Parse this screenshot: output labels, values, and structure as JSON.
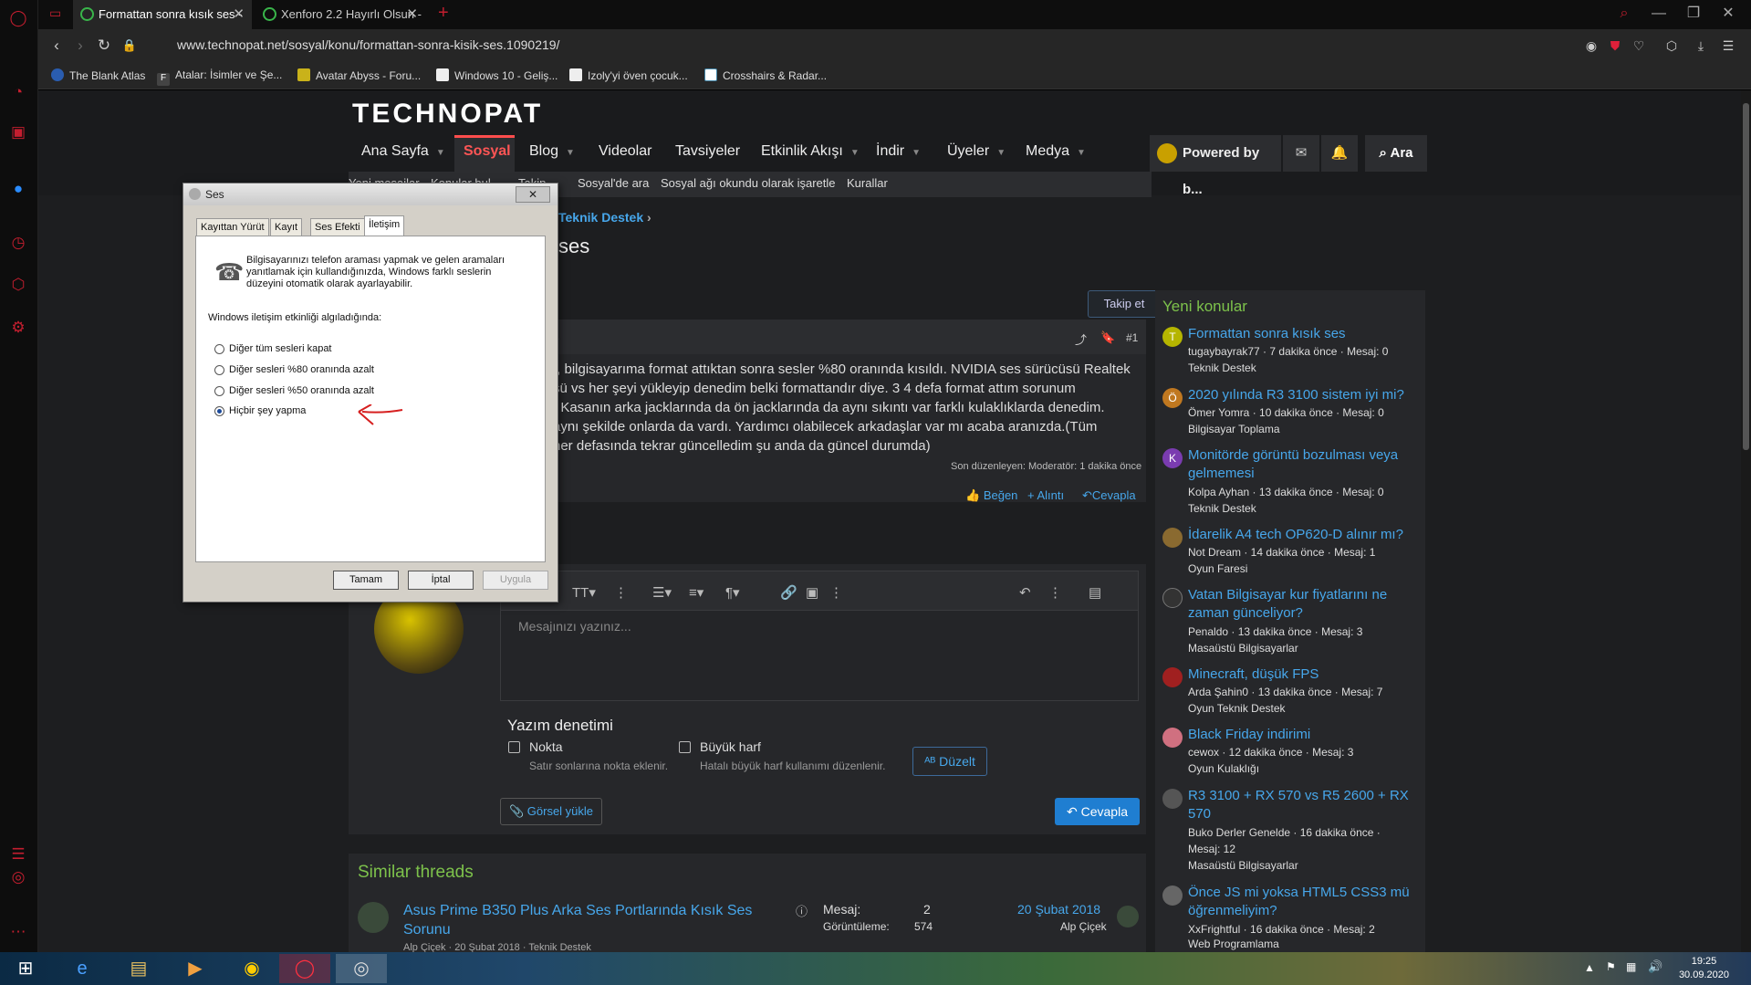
{
  "browser": {
    "tabs": [
      {
        "title": "Formattan sonra kısık ses -",
        "active": true
      },
      {
        "title": "Xenforo 2.2 Hayırlı Olsun -",
        "active": false
      }
    ],
    "url": "www.technopat.net/sosyal/konu/formattan-sonra-kisik-ses.1090219/",
    "bookmarks": [
      "The Blank Atlas",
      "Atalar: İsimler ve Şe...",
      "Avatar Abyss - Foru...",
      "Windows 10 - Geliş...",
      "Izoly'yi öven çocuk...",
      "Crosshairs & Radar..."
    ]
  },
  "site": {
    "logo": "TECHNOPAT",
    "nav": [
      "Ana Sayfa",
      "Sosyal",
      "Blog",
      "Videolar",
      "Tavsiyeler",
      "Etkinlik Akışı",
      "İndir",
      "Üyeler",
      "Medya"
    ],
    "subnav": [
      "Yeni mesajlar",
      "Konular bul",
      "Takip",
      "Sosyal'de ara",
      "Sosyal ağı okundu olarak işaretle",
      "Kurallar"
    ],
    "user": "Powered by b...",
    "search": "Ara"
  },
  "thread": {
    "breadcrumb": "Teknik Destek",
    "title_tail": "ses",
    "follow": "Takip et",
    "post_number": "#1",
    "post_lines": [
      "r, bilgisayarıma format attıktan sonra sesler %80 oranında kısıldı. NVIDIA ses sürücüsü Realtek",
      "sü vs her şeyi yükleyip denedim belki formattandır diye. 3 4 defa format attım sorunum",
      ". Kasanın arka jacklarında da ön jacklarında da aynı sıkıntı var farklı kulaklıklarda denedim.",
      "aynı şekilde onlarda da vardı. Yardımcı olabilecek arkadaşlar var mı acaba aranızda.(Tüm",
      "her defasında tekrar güncelledim şu anda da güncel durumda)"
    ],
    "edited": "Son düzenleyen: Moderatör: 1 dakika önce",
    "actions": [
      "Beğen",
      "+ Alıntı",
      "Cevapla"
    ]
  },
  "reply": {
    "placeholder": "Mesajınızı yazınız...",
    "spell_title": "Yazım denetimi",
    "opt1_label": "Nokta",
    "opt1_desc": "Satır sonlarına nokta eklenir.",
    "opt2_label": "Büyük harf",
    "opt2_desc": "Hatalı büyük harf kullanımı düzenlenir.",
    "fix_button": "Düzelt",
    "upload_button": "Görsel yükle",
    "reply_button": "Cevapla"
  },
  "similar": {
    "title": "Similar threads",
    "item_title_1": "Asus Prime B350 Plus Arka Ses Portlarında Kısık Ses",
    "item_title_2": "Sorunu",
    "item_meta": "Alp Çiçek · 20 Şubat 2018 · Teknik Destek",
    "mesaj_label": "Mesaj:",
    "mesaj_value": "2",
    "views_label": "Görüntüleme:",
    "views_value": "574",
    "date": "20 Şubat 2018",
    "author": "Alp Çiçek"
  },
  "sidebar_right": {
    "title": "Yeni konular",
    "items": [
      {
        "avatar": "T",
        "color": "#b5b500",
        "title1": "Formattan sonra kısık ses",
        "title2": "",
        "meta1": "tugaybayrak77 · 7 dakika önce · Mesaj: 0",
        "meta2": "Teknik Destek"
      },
      {
        "avatar": "Ö",
        "color": "#c07820",
        "title1": "2020 yılında R3 3100 sistem iyi mi?",
        "title2": "",
        "meta1": "Ömer Yomra · 10 dakika önce · Mesaj: 0",
        "meta2": "Bilgisayar Toplama"
      },
      {
        "avatar": "K",
        "color": "#7a3cb0",
        "title1": "Monitörde görüntü bozulması veya",
        "title2": "gelmemesi",
        "meta1": "Kolpa Ayhan · 13 dakika önce · Mesaj: 0",
        "meta2": "Teknik Destek"
      },
      {
        "avatar": "",
        "color": "#8a6a30",
        "title1": "İdarelik A4 tech OP620-D alınır mı?",
        "title2": "",
        "meta1": "Not Dream · 14 dakika önce · Mesaj: 1",
        "meta2": "Oyun Faresi"
      },
      {
        "avatar": "",
        "color": "#333",
        "title1": "Vatan Bilgisayar kur fiyatlarını ne",
        "title2": "zaman günceliyor?",
        "meta1": "Penaldo · 13 dakika önce · Mesaj: 3",
        "meta2": "Masaüstü Bilgisayarlar"
      },
      {
        "avatar": "",
        "color": "#a02020",
        "title1": "Minecraft, düşük FPS",
        "title2": "",
        "meta1": "Arda Şahin0 · 13 dakika önce · Mesaj: 7",
        "meta2": "Oyun Teknik Destek"
      },
      {
        "avatar": "",
        "color": "#d07080",
        "title1": "Black Friday indirimi",
        "title2": "",
        "meta1": "cewox · 12 dakika önce · Mesaj: 3",
        "meta2": "Oyun Kulaklığı"
      },
      {
        "avatar": "",
        "color": "#555",
        "title1": "R3 3100 + RX 570 vs R5 2600 + RX",
        "title2": "570",
        "meta1": "Buko Derler Genelde · 16 dakika önce ·",
        "meta2": "Mesaj: 12",
        "meta3": "Masaüstü Bilgisayarlar"
      },
      {
        "avatar": "",
        "color": "#666",
        "title1": "Önce JS mi yoksa HTML5 CSS3 mü",
        "title2": "öğrenmeliyim?",
        "meta1": "XxFrightful · 16 dakika önce · Mesaj: 2",
        "meta2": "Web Programlama"
      }
    ]
  },
  "dialog": {
    "title": "Ses",
    "tabs": [
      "Kayıttan Yürüt",
      "Kayıt",
      "Ses Efekti",
      "İletişim"
    ],
    "desc_lines": [
      "Bilgisayarınızı telefon araması yapmak ve gelen aramaları",
      "yanıtlamak için kullandığınızda, Windows farklı seslerin",
      "düzeyini otomatik olarak ayarlayabilir."
    ],
    "prompt": "Windows iletişim etkinliği algıladığında:",
    "options": [
      "Diğer tüm sesleri kapat",
      "Diğer sesleri %80 oranında azalt",
      "Diğer sesleri %50 oranında azalt",
      "Hiçbir şey yapma"
    ],
    "selected_option": 3,
    "buttons": [
      "Tamam",
      "İptal",
      "Uygula"
    ]
  },
  "taskbar": {
    "time": "19:25",
    "date": "30.09.2020"
  }
}
